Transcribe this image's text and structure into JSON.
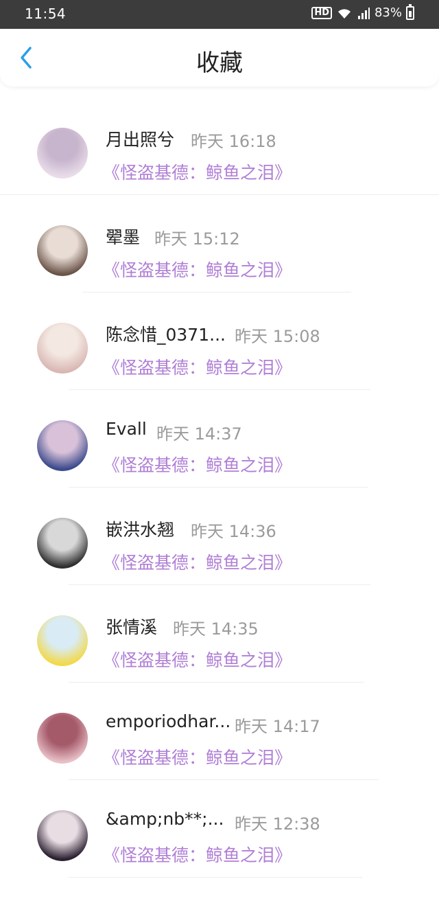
{
  "status_bar": {
    "time": "11:54",
    "hd": "HD",
    "battery": "83%"
  },
  "header": {
    "title": "收藏"
  },
  "items": [
    {
      "name": "月出照兮",
      "time": "昨天 16:18",
      "work": "《怪盗基德：鲸鱼之泪》",
      "avatar_colors": [
        "#e9dde9",
        "#c7b4cd"
      ]
    },
    {
      "name": "翚墨",
      "time": "昨天 15:12",
      "work": "《怪盗基德：鲸鱼之泪》",
      "avatar_colors": [
        "#6b5449",
        "#e8dcd5"
      ]
    },
    {
      "name": "陈念惜_0371...",
      "time": "昨天 15:08",
      "work": "《怪盗基德：鲸鱼之泪》",
      "avatar_colors": [
        "#d9b7b3",
        "#f4e8e2"
      ]
    },
    {
      "name": "Evall",
      "time": "昨天 14:37",
      "work": "《怪盗基德：鲸鱼之泪》",
      "avatar_colors": [
        "#3b4a8c",
        "#d9c2d9"
      ]
    },
    {
      "name": "嵌洪水翘",
      "time": "昨天 14:36",
      "work": "《怪盗基德：鲸鱼之泪》",
      "avatar_colors": [
        "#2e2e2e",
        "#d8d8d8"
      ]
    },
    {
      "name": "张情溪",
      "time": "昨天 14:35",
      "work": "《怪盗基德：鲸鱼之泪》",
      "avatar_colors": [
        "#f2d94a",
        "#d9ecf5"
      ]
    },
    {
      "name": "emporiodhar...",
      "time": "昨天 14:17",
      "work": "《怪盗基德：鲸鱼之泪》",
      "avatar_colors": [
        "#e9c0c7",
        "#a55a6a"
      ]
    },
    {
      "name": "&amp;nb**;...",
      "time": "昨天 12:38",
      "work": "《怪盗基德：鲸鱼之泪》",
      "avatar_colors": [
        "#2a2030",
        "#e8dde3"
      ]
    }
  ]
}
